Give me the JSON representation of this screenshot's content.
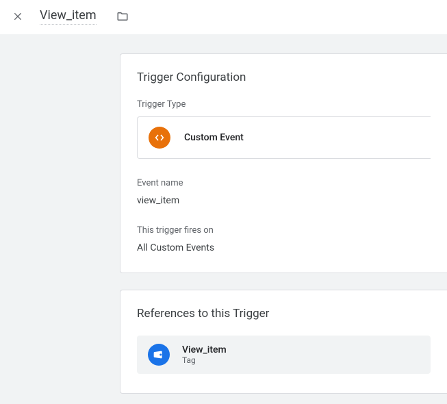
{
  "header": {
    "title": "View_item"
  },
  "trigger_config": {
    "section_title": "Trigger Configuration",
    "type_label": "Trigger Type",
    "type_value": "Custom Event",
    "event_name_label": "Event name",
    "event_name_value": "view_item",
    "fires_on_label": "This trigger fires on",
    "fires_on_value": "All Custom Events"
  },
  "references": {
    "section_title": "References to this Trigger",
    "items": [
      {
        "name": "View_item",
        "type": "Tag"
      }
    ]
  }
}
